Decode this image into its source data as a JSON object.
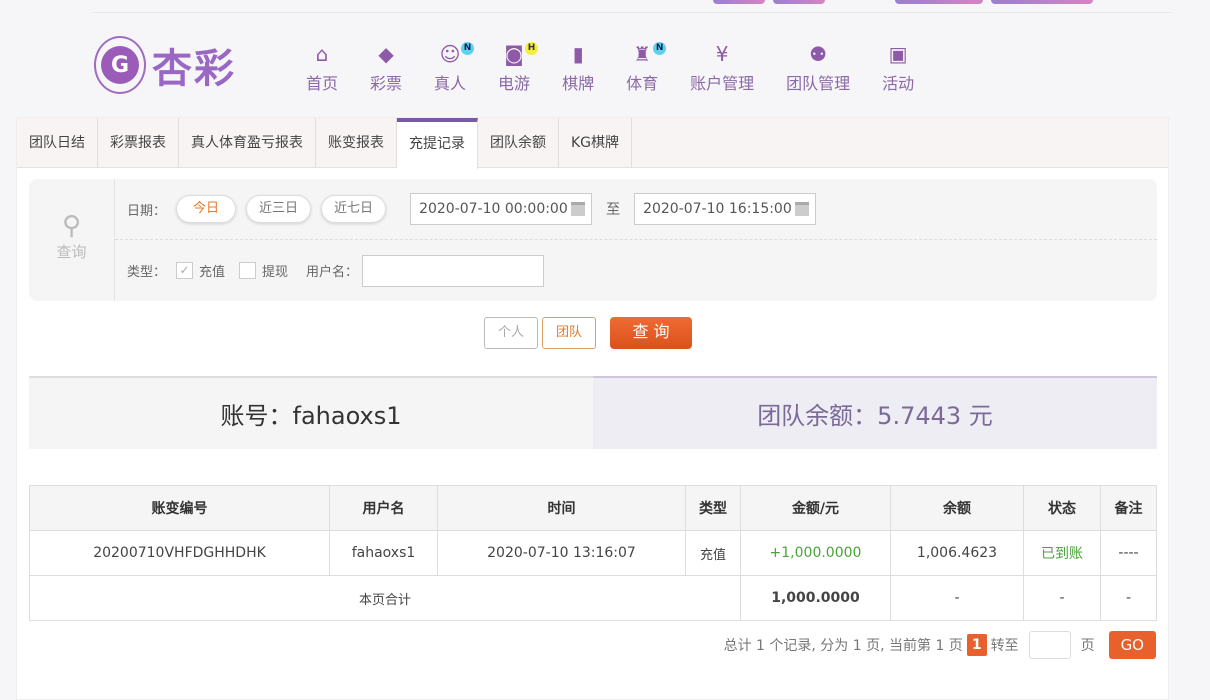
{
  "brand": {
    "name": "杏彩",
    "emblem": "G"
  },
  "nav": [
    {
      "label": "首页",
      "icon": "home-icon"
    },
    {
      "label": "彩票",
      "icon": "ticket-icon"
    },
    {
      "label": "真人",
      "icon": "live-dealer-icon",
      "badge": "N"
    },
    {
      "label": "电游",
      "icon": "gamepad-icon",
      "badge": "H"
    },
    {
      "label": "棋牌",
      "icon": "cards-icon"
    },
    {
      "label": "体育",
      "icon": "trophy-icon",
      "badge": "N"
    },
    {
      "label": "账户管理",
      "icon": "yen-icon"
    },
    {
      "label": "团队管理",
      "icon": "team-icon"
    },
    {
      "label": "活动",
      "icon": "gift-icon"
    }
  ],
  "tabs": [
    "团队日结",
    "彩票报表",
    "真人体育盈亏报表",
    "账变报表",
    "充提记录",
    "团队余额",
    "KG棋牌"
  ],
  "active_tab": "充提记录",
  "query": {
    "side_label": "查询",
    "date_label": "日期：",
    "quick": [
      "今日",
      "近三日",
      "近七日"
    ],
    "start": "2020-07-10 00:00:00",
    "to": "至",
    "end": "2020-07-10 16:15:00",
    "type_label": "类型：",
    "types": [
      {
        "label": "充值",
        "checked": true
      },
      {
        "label": "提现",
        "checked": false
      }
    ],
    "username_label": "用户名：",
    "username": ""
  },
  "buttons": {
    "personal": "个人",
    "team": "团队",
    "search": "查 询"
  },
  "summary": {
    "account": "账号：fahaoxs1",
    "balance": "团队余额：5.7443 元"
  },
  "table": {
    "headers": [
      "账变编号",
      "用户名",
      "时间",
      "类型",
      "金额/元",
      "余额",
      "状态",
      "备注"
    ],
    "rows": [
      [
        "20200710VHFDGHHDHK",
        "fahaoxs1",
        "2020-07-10 13:16:07",
        "充值",
        "+1,000.0000",
        "1,006.4623",
        "已到账",
        "----"
      ]
    ],
    "total": {
      "label": "本页合计",
      "amount": "1,000.0000",
      "balance": "-",
      "status": "-",
      "note": "-"
    }
  },
  "pager": {
    "info": "总计 1 个记录, 分为 1 页, 当前第 1 页",
    "current": "1",
    "goto": "转至",
    "page": "页",
    "go": "GO"
  },
  "colors": {
    "accent": "#e8612c",
    "purple": "#8e5aa8",
    "green": "#4aa33a"
  }
}
